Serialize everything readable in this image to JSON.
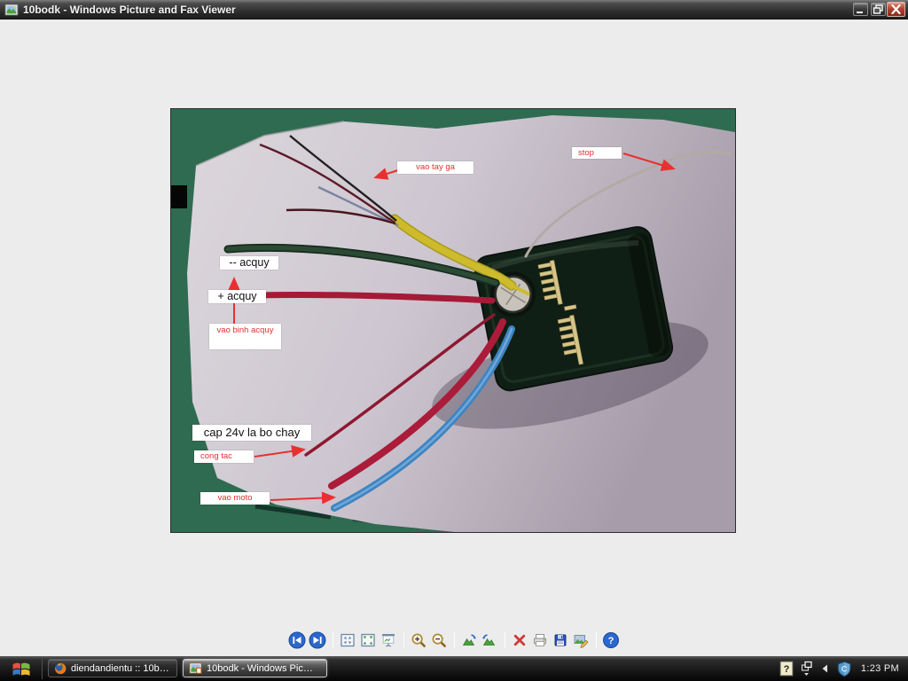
{
  "window": {
    "title": "10bodk - Windows Picture and Fax Viewer",
    "controls": [
      "minimize",
      "restore",
      "close"
    ]
  },
  "viewer": {
    "toolbar_icons": [
      "previous-image",
      "next-image",
      "best-fit",
      "actual-size",
      "start-slideshow",
      "zoom-in",
      "zoom-out",
      "rotate-clockwise",
      "rotate-counterclockwise",
      "delete",
      "print",
      "save",
      "edit",
      "help"
    ],
    "help_glyph": "?"
  },
  "photo": {
    "annotations": {
      "vao_tay_ga": "vao tay ga",
      "stop": "stop",
      "minus_acquy": "-- acquy",
      "plus_acquy": "+ acquy",
      "vao_binh_acquy": "vao binh acquy",
      "cap_24v": "cap 24v la bo chay",
      "cong_tac": "cong tac",
      "vao_moto": "vao moto"
    }
  },
  "taskbar": {
    "buttons": [
      {
        "label": "diendandientu :: 10b…",
        "icon": "firefox"
      },
      {
        "label": "10bodk - Windows Pic…",
        "icon": "picture-viewer",
        "active": true
      }
    ],
    "tray": {
      "icons": [
        "language-help",
        "display",
        "hide-icons-chevron",
        "security-shield"
      ],
      "help_glyph": "?",
      "shield_glyph": "C",
      "clock": "1:23 PM"
    }
  },
  "colors": {
    "annotation_red": "#e03030",
    "paper": "#cdc6d0",
    "table_green": "#2f6b50",
    "titlebar_gray": "#3a3a3a",
    "taskbar_black": "#191919"
  }
}
